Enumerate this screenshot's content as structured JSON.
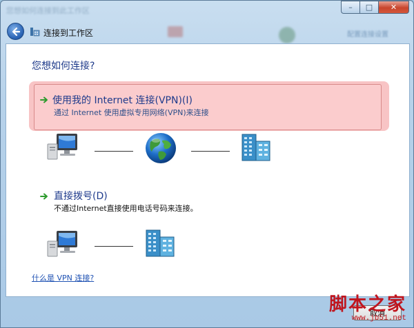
{
  "window": {
    "title_blurred": "您想如何连接到此工作区",
    "nav_title": "连接到工作区",
    "background_ghost_text": "配置连接设置"
  },
  "window_controls": {
    "minimize": "–",
    "maximize": "□",
    "close": "✕"
  },
  "main": {
    "question": "您想如何连接?",
    "options": [
      {
        "title": "使用我的 Internet 连接(VPN)(I)",
        "description": "通过 Internet 使用虚拟专用网络(VPN)来连接",
        "highlighted": true
      },
      {
        "title": "直接拨号(D)",
        "description": "不通过Internet直接使用电话号码来连接。",
        "highlighted": false
      }
    ],
    "help_link": "什么是 VPN 连接?"
  },
  "footer": {
    "cancel_label": "取消"
  },
  "watermark": {
    "text": "脚本之家",
    "url": "www.jb51.net"
  },
  "icons": {
    "back": "back-arrow-icon",
    "app": "network-workplace-icon",
    "computer": "computer-icon",
    "globe": "globe-internet-icon",
    "server": "server-building-icon",
    "option_arrow": "green-arrow-icon"
  },
  "colors": {
    "accent_blue": "#1f3b8c",
    "highlight": "#f3a0a2",
    "link": "#1f52b3",
    "close_red": "#c8452d",
    "arrow_green": "#2e9b2e",
    "watermark_red": "#c0151e"
  }
}
